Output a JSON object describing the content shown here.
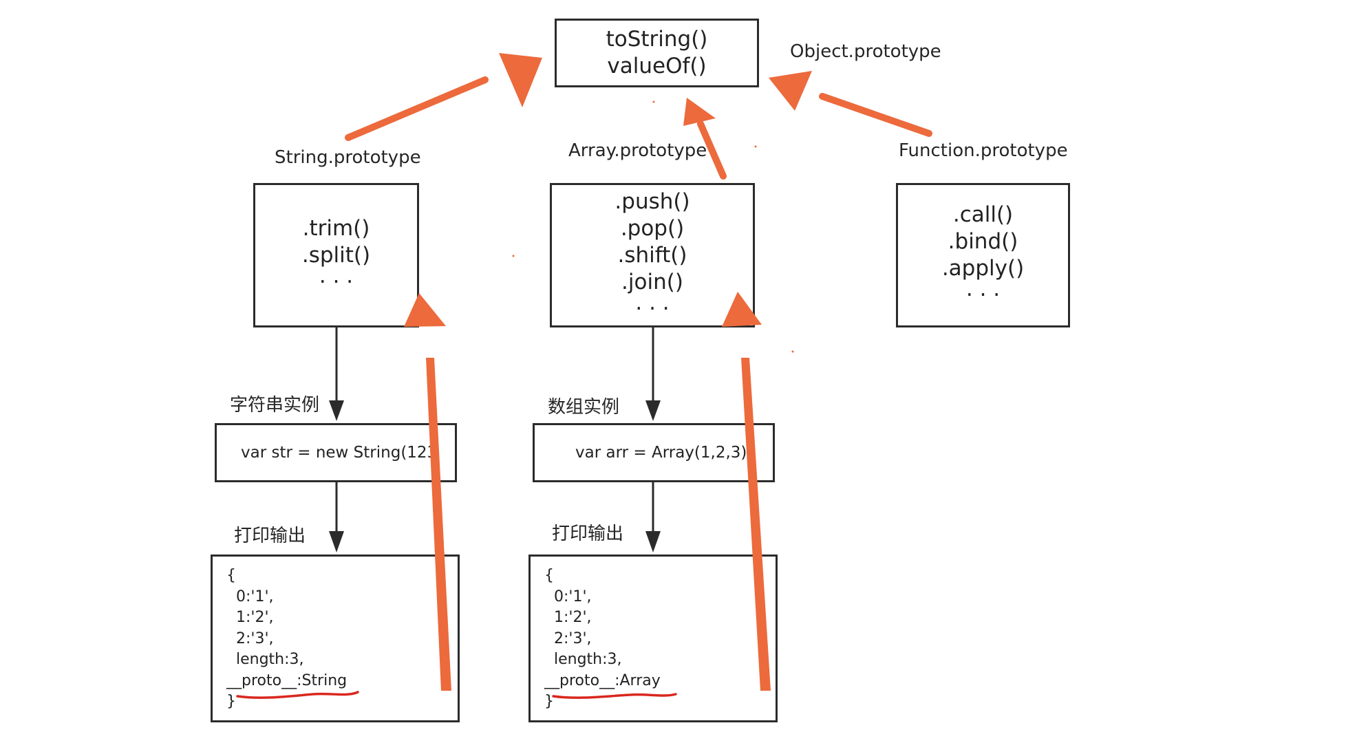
{
  "object_proto": {
    "label": "Object.prototype",
    "methods": [
      "toString()",
      "valueOf()"
    ]
  },
  "string_proto": {
    "label": "String.prototype",
    "methods": [
      ".trim()",
      ".split()",
      "· · ·"
    ]
  },
  "array_proto": {
    "label": "Array.prototype",
    "methods": [
      ".push()",
      ".pop()",
      ".shift()",
      ".join()",
      "· · ·"
    ]
  },
  "function_proto": {
    "label": "Function.prototype",
    "methods": [
      ".call()",
      ".bind()",
      ".apply()",
      "· · ·"
    ]
  },
  "string_instance": {
    "label": "字符串实例",
    "code": "var str = new String(123",
    "output_label": "打印输出",
    "output_lines": [
      "{",
      "  0:'1',",
      "  1:'2',",
      "  2:'3',",
      "  length:3,",
      "__proto__:String",
      "}"
    ]
  },
  "array_instance": {
    "label": "数组实例",
    "code": "var arr = Array(1,2,3)",
    "output_label": "打印输出",
    "output_lines": [
      "{",
      "  0:'1',",
      "  1:'2',",
      "  2:'3',",
      "  length:3,",
      "__proto__:Array",
      "}"
    ]
  },
  "colors": {
    "arrow_orange": "#EC6A3C",
    "underline_red": "#D9271E",
    "box_border": "#2B2B2B"
  }
}
